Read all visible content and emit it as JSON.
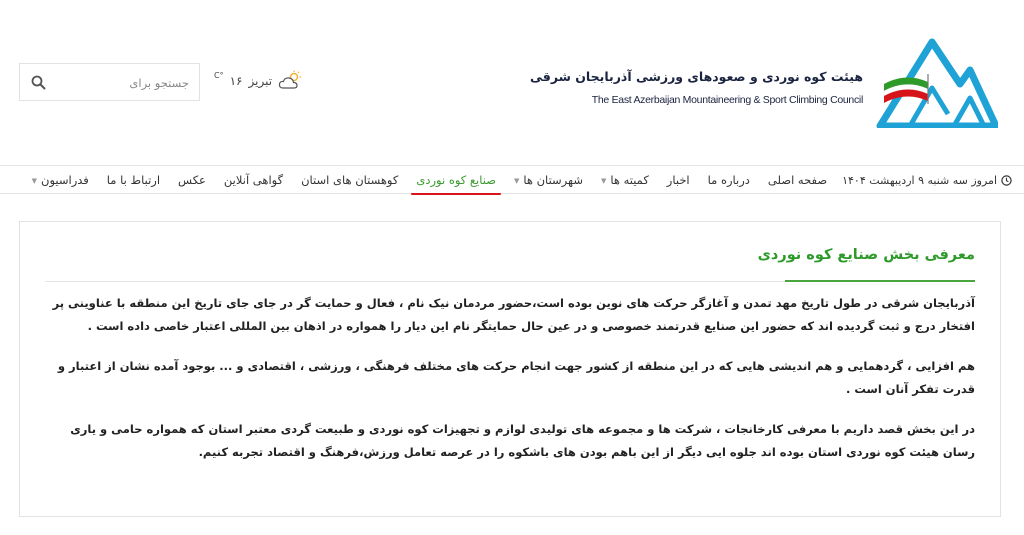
{
  "header": {
    "title_fa": "هیئت کوه نوردی و صعودهای ورزشی آذربایجان شرقی",
    "title_en": "The East Azerbaijan Mountaineering & Sport Climbing Council",
    "weather": {
      "city": "تبریز",
      "temp": "۱۶",
      "unit": "°C",
      "icon": "partly-cloudy-icon"
    },
    "search": {
      "placeholder": "جستجو برای",
      "icon": "search-icon"
    }
  },
  "nav": {
    "date": "امروز سه شنبه ۹ اردیبهشت ۱۴۰۴",
    "items": [
      {
        "label": "صفحه اصلی"
      },
      {
        "label": "درباره ما"
      },
      {
        "label": "اخبار"
      },
      {
        "label": "کمیته ها"
      },
      {
        "label": "شهرستان ها"
      },
      {
        "label": "صنایع کوه نوردی"
      },
      {
        "label": "کوهستان های استان"
      },
      {
        "label": "گواهی آنلاین"
      },
      {
        "label": "عکس"
      },
      {
        "label": "ارتباط با ما"
      },
      {
        "label": "فدراسیون"
      }
    ]
  },
  "content": {
    "title": "معرفی بخش صنایع کوه نوردی",
    "paragraphs": [
      "آذربایجان شرقی در طول تاریخ مهد تمدن و آغازگر حرکت های نوین بوده است،حضور مردمان نیک نام ، فعال و حمایت گر در جای جای تاریخ این منطقه با عناوینی پر افتخار درج و ثبت گردیده اند که حضور این صنایع قدرتمند خصوصی و در عین حال حمایتگر نام این دیار را همواره در اذهان بین المللی اعتبار خاصی داده است .",
      "هم افزایی ، گردهمایی و هم اندیشی هایی که در این منطقه از کشور جهت انجام حرکت های مختلف فرهنگی ، ورزشی ، اقتصادی و ... بوجود آمده نشان از اعتبار و قدرت تفکر آنان است .",
      "در این بخش قصد داریم با معرفی کارخانجات ، شرکت ها و مجموعه های تولیدی لوازم و تجهیزات کوه نوردی و طبیعت گردی معتبر استان که همواره حامی و یاری رسان هیئت کوه نوردی استان بوده اند جلوه ایی دیگر از این باهم بودن های باشکوه را در عرصه تعامل ورزش،فرهنگ و اقتصاد تجربه کنیم."
    ]
  },
  "colors": {
    "accent_green": "#2e9a2a",
    "active_underline": "#d6141a",
    "logo_blue": "#1fa3d6"
  }
}
